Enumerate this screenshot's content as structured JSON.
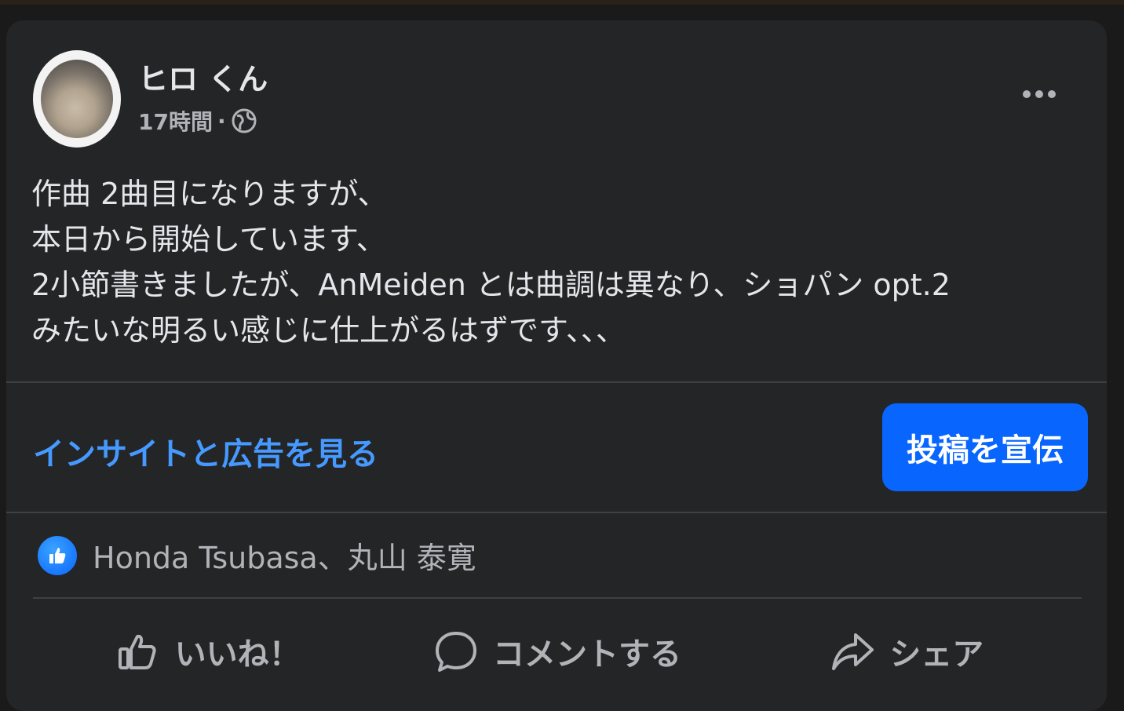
{
  "post": {
    "author": "ヒロ くん",
    "time": "17時間",
    "separator": "·",
    "privacy_icon": "globe-icon",
    "more_icon": "more-options-icon",
    "text_lines": [
      "作曲 2曲目になりますが、",
      "本日から開始しています、",
      "2小節書きましたが、AnMeiden とは曲調は異なり、ショパン opt.2",
      "みたいな明るい感じに仕上がるはずです、、、"
    ]
  },
  "promo": {
    "insights_label": "インサイトと広告を見る",
    "boost_label": "投稿を宣伝"
  },
  "reactions": {
    "icon": "like-reaction-icon",
    "names": "Honda Tsubasa、丸山 泰寛"
  },
  "actions": {
    "like_label": "いいね！",
    "comment_label": "コメントする",
    "share_label": "シェア"
  },
  "colors": {
    "card_bg": "#242526",
    "primary_text": "#e4e6eb",
    "secondary_text": "#b0b3b8",
    "link": "#4599ff",
    "accent_button": "#0866ff"
  }
}
